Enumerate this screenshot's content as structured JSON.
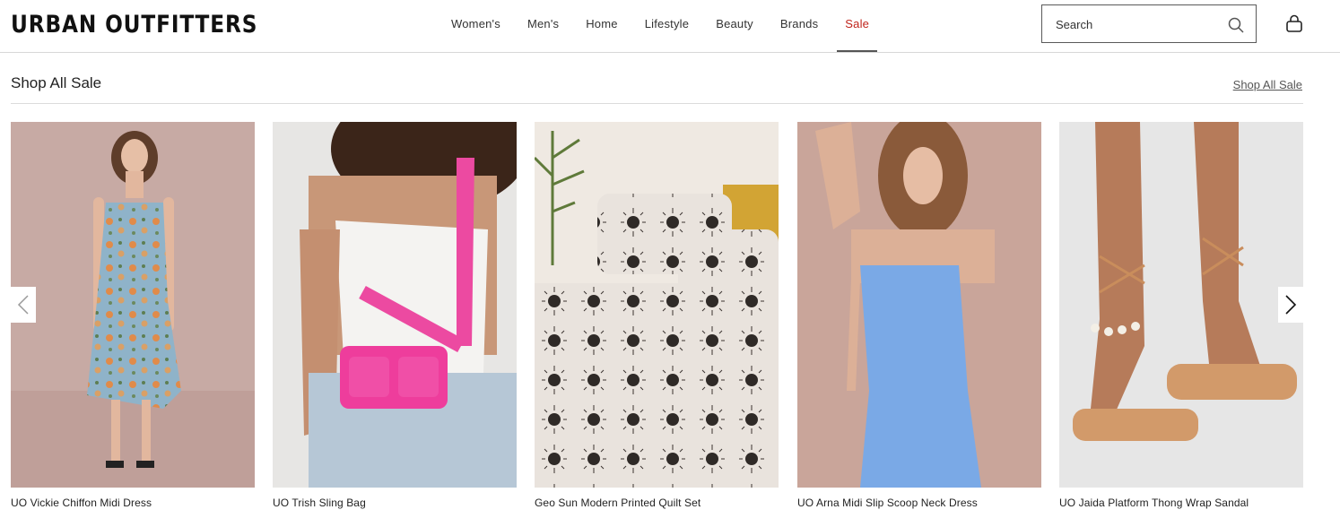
{
  "brand": {
    "logo_text": "URBAN OUTFITTERS"
  },
  "nav": {
    "items": [
      {
        "label": "Women's",
        "name": "nav-womens"
      },
      {
        "label": "Men's",
        "name": "nav-mens"
      },
      {
        "label": "Home",
        "name": "nav-home"
      },
      {
        "label": "Lifestyle",
        "name": "nav-lifestyle"
      },
      {
        "label": "Beauty",
        "name": "nav-beauty"
      },
      {
        "label": "Brands",
        "name": "nav-brands"
      },
      {
        "label": "Sale",
        "name": "nav-sale",
        "active": true
      }
    ],
    "sale_color": "#c0251c"
  },
  "search": {
    "placeholder": "Search",
    "icon": "search-icon"
  },
  "cart": {
    "icon": "shopping-bag-icon"
  },
  "section": {
    "title": "Shop All Sale",
    "link_label": "Shop All Sale"
  },
  "carousel": {
    "prev_icon": "chevron-left-icon",
    "next_icon": "chevron-right-icon",
    "products": [
      {
        "name": "UO Vickie Chiffon Midi Dress"
      },
      {
        "name": "UO Trish Sling Bag"
      },
      {
        "name": "Geo Sun Modern Printed Quilt Set"
      },
      {
        "name": "UO Arna Midi Slip Scoop Neck Dress"
      },
      {
        "name": "UO Jaida Platform Thong Wrap Sandal"
      }
    ]
  }
}
